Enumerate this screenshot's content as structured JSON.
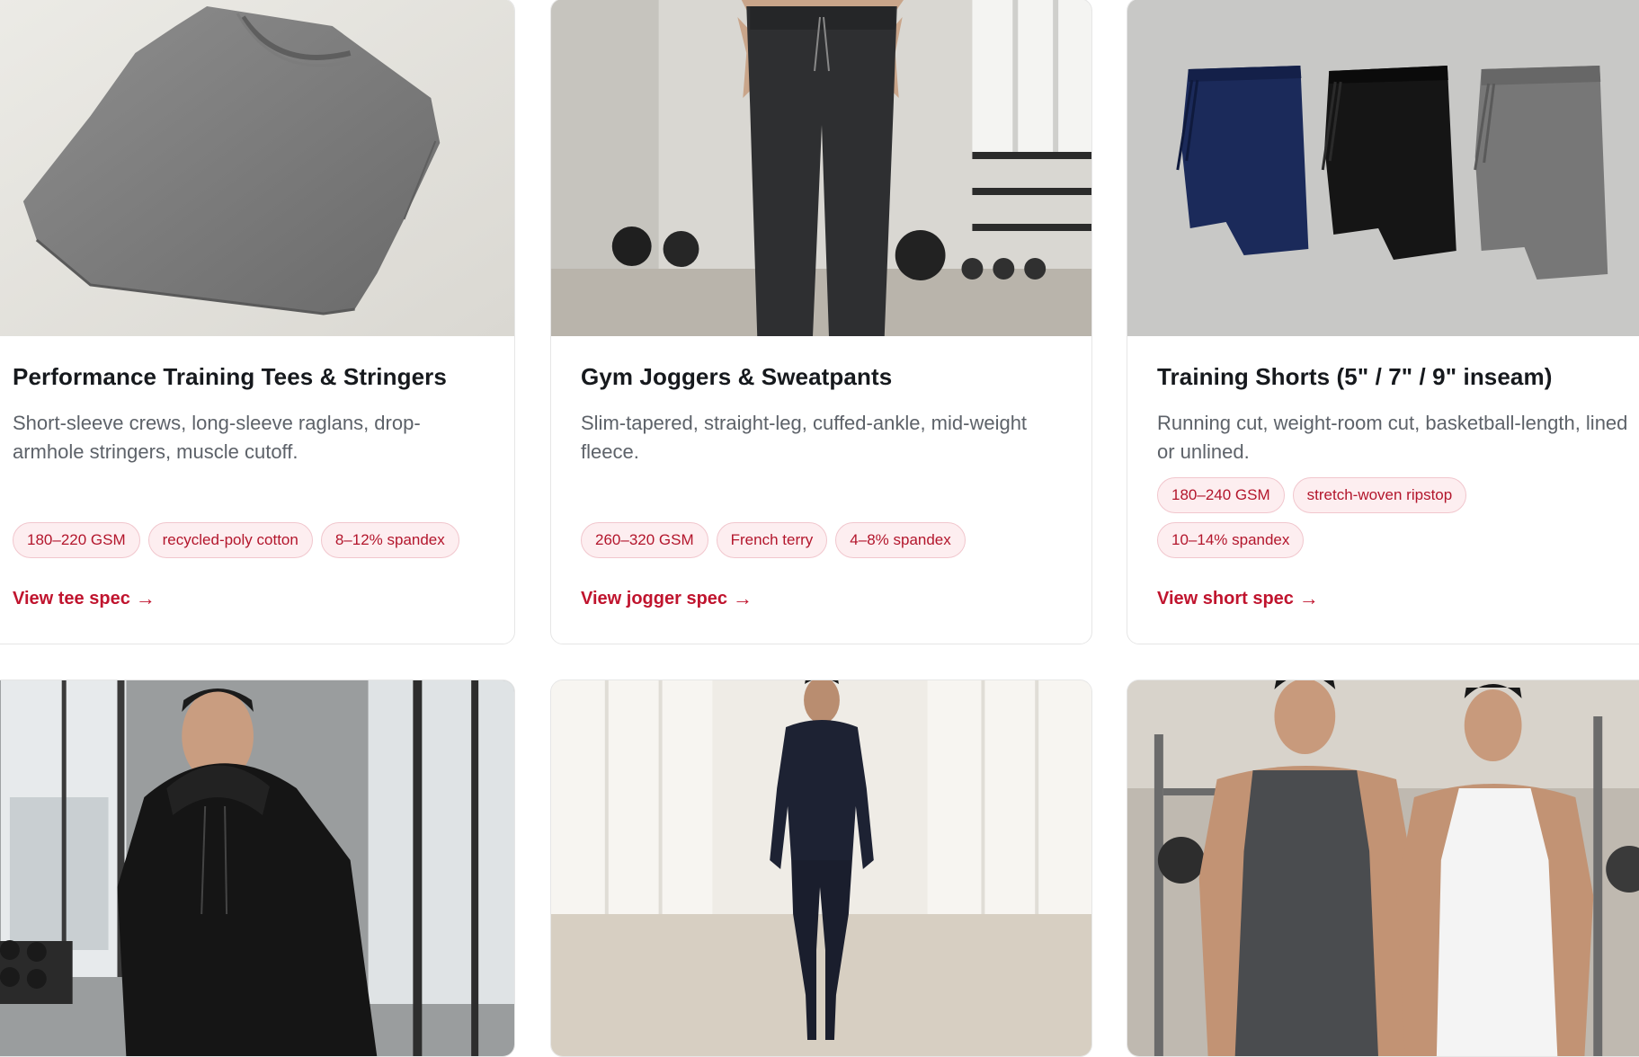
{
  "cards": [
    {
      "title": "Performance Training Tees & Stringers",
      "description": "Short-sleeve crews, long-sleeve raglans, drop-armhole stringers, muscle cutoff.",
      "tags": [
        "180–220 GSM",
        "recycled-poly cotton",
        "8–12% spandex"
      ],
      "cta": "View tee spec",
      "arrow": "→",
      "photo": "folded-gray-tee-photo"
    },
    {
      "title": "Gym Joggers & Sweatpants",
      "description": "Slim-tapered, straight-leg, cuffed-ankle, mid-weight fleece.",
      "tags": [
        "260–320 GSM",
        "French terry",
        "4–8% spandex"
      ],
      "cta": "View jogger spec",
      "arrow": "→",
      "photo": "joggers-gym-photo"
    },
    {
      "title": "Training Shorts (5\" / 7\" / 9\" inseam)",
      "description": "Running cut, weight-room cut, basketball-length, lined or unlined.",
      "tags": [
        "180–240 GSM",
        "stretch-woven ripstop",
        "10–14% spandex"
      ],
      "cta": "View short spec",
      "arrow": "→",
      "photo": "three-shorts-photo"
    },
    {
      "photo": "black-hoodie-model-photo"
    },
    {
      "photo": "compression-set-model-photo"
    },
    {
      "photo": "tank-tops-models-photo"
    }
  ],
  "colors": {
    "accent": "#c0142e",
    "tag_bg": "#fdeef0",
    "tag_border": "#f1c6cd",
    "title": "#16191d",
    "body_text": "#5d6269"
  }
}
